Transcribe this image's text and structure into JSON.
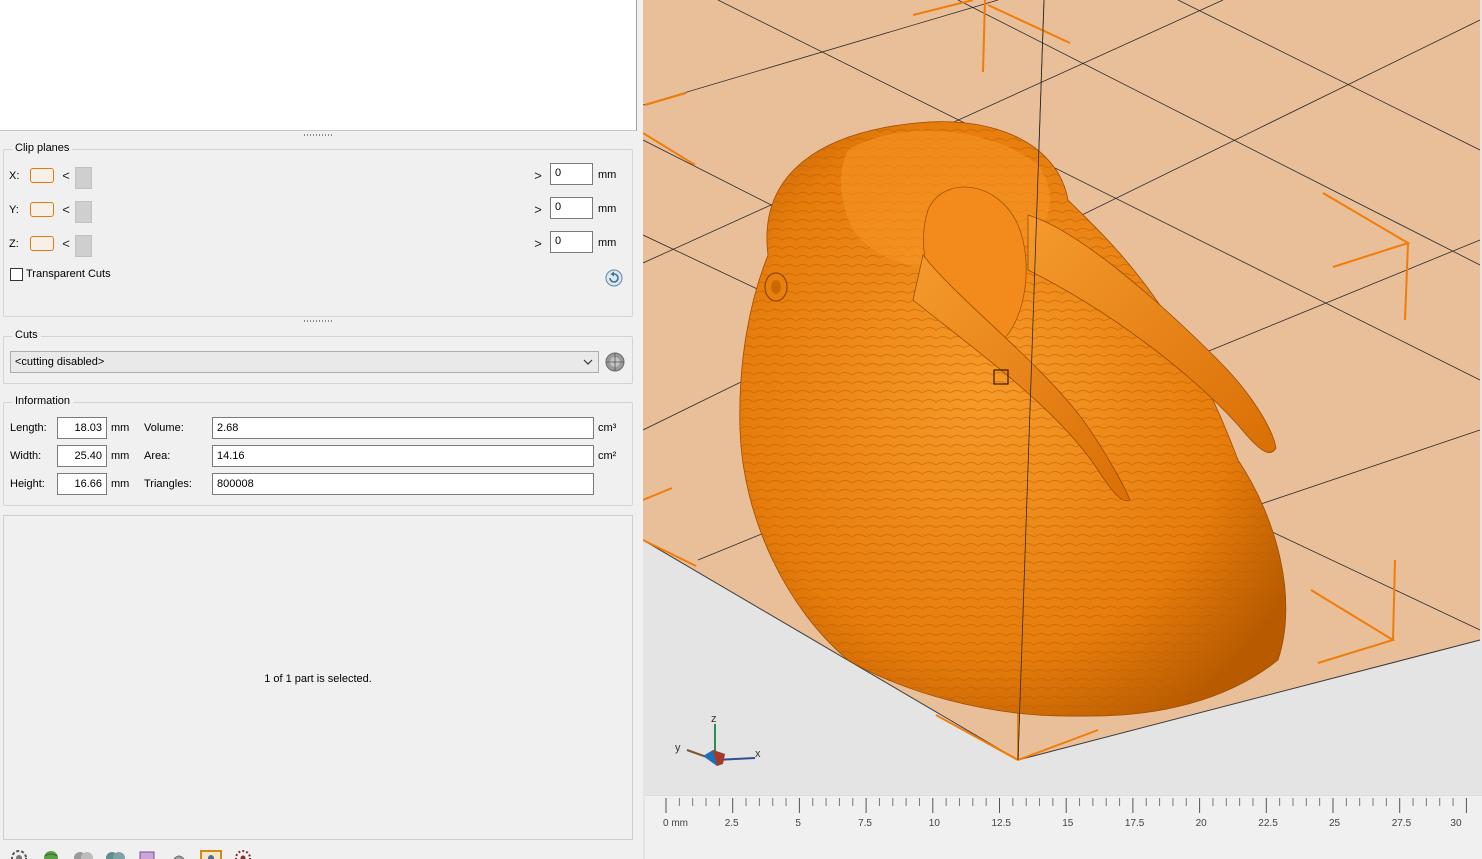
{
  "clip_planes": {
    "title": "Clip planes",
    "rows": [
      {
        "axis": "X:",
        "value": "0",
        "unit": "mm"
      },
      {
        "axis": "Y:",
        "value": "0",
        "unit": "mm"
      },
      {
        "axis": "Z:",
        "value": "0",
        "unit": "mm"
      }
    ],
    "prev_arrow": "<",
    "next_arrow": ">",
    "transparent_cuts_label": "Transparent Cuts",
    "transparent_cuts_checked": false
  },
  "cuts": {
    "title": "Cuts",
    "selected": "<cutting disabled>"
  },
  "information": {
    "title": "Information",
    "length_label": "Length:",
    "length_value": "18.03",
    "width_label": "Width:",
    "width_value": "25.40",
    "height_label": "Height:",
    "height_value": "16.66",
    "dim_unit": "mm",
    "volume_label": "Volume:",
    "volume_value": "2.68",
    "volume_unit": "cm³",
    "area_label": "Area:",
    "area_value": "14.16",
    "area_unit": "cm²",
    "triangles_label": "Triangles:",
    "triangles_value": "800008"
  },
  "status": {
    "text": "1 of 1 part is selected."
  },
  "toolbar": {
    "icons": [
      "settings-gear-icon",
      "globe-icon",
      "spheres-icon",
      "shaded-spheres-icon",
      "cube-icon",
      "dome-icon",
      "view-frame-icon",
      "gear-grid-icon"
    ]
  },
  "viewport": {
    "model_color": "#f18a1a",
    "bed_color": "#e9bf9a",
    "gizmo": {
      "z": "z",
      "y": "y",
      "x": "x"
    },
    "ruler_labels": [
      "0 mm",
      "2.5",
      "5",
      "7.5",
      "10",
      "12.5",
      "15",
      "17.5",
      "20",
      "22.5",
      "25",
      "27.5",
      "30"
    ]
  }
}
